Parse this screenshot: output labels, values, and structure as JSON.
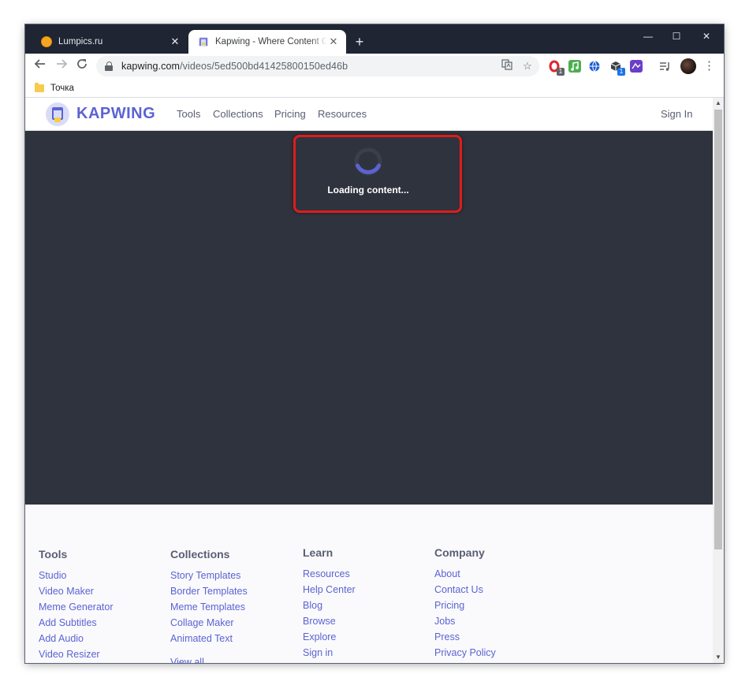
{
  "browser": {
    "tabs": [
      {
        "title": "Lumpics.ru",
        "active": false
      },
      {
        "title": "Kapwing - Where Content Creati",
        "active": true
      }
    ],
    "url_host": "kapwing.com",
    "url_path": "/videos/5ed500bd41425800150ed46b",
    "bookmarks": [
      "Точка"
    ],
    "icons": {
      "back": "back-arrow-icon",
      "forward": "forward-arrow-icon",
      "reload": "reload-icon",
      "translate": "translate-icon",
      "star": "bookmark-star-icon"
    },
    "extension_badges": [
      "1",
      "1"
    ]
  },
  "site": {
    "brand": "KAPWING",
    "nav": [
      "Tools",
      "Collections",
      "Pricing",
      "Resources"
    ],
    "sign_in": "Sign In",
    "accent_color": "#5b63d3"
  },
  "stage": {
    "loading_text": "Loading content...",
    "background_color": "#2f333d",
    "highlight_color": "#e01c1c"
  },
  "footer": {
    "tools": {
      "heading": "Tools",
      "links": [
        "Studio",
        "Video Maker",
        "Meme Generator",
        "Add Subtitles",
        "Add Audio",
        "Video Resizer"
      ]
    },
    "collections": {
      "heading": "Collections",
      "links": [
        "Story Templates",
        "Border Templates",
        "Meme Templates",
        "Collage Maker",
        "Animated Text",
        "View all"
      ]
    },
    "learn": {
      "heading": "Learn",
      "links": [
        "Resources",
        "Help Center",
        "Blog",
        "Browse",
        "Explore",
        "Sign in"
      ]
    },
    "company": {
      "heading": "Company",
      "links": [
        "About",
        "Contact Us",
        "Pricing",
        "Jobs",
        "Press",
        "Privacy Policy"
      ]
    }
  }
}
